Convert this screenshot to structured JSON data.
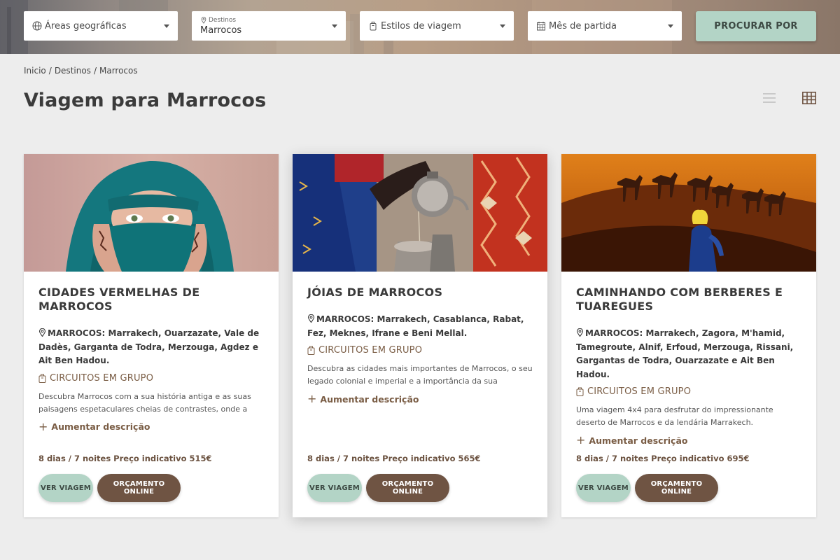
{
  "search": {
    "areas_label": "Áreas geográficas",
    "destinations_caption": "Destinos",
    "destinations_value": "Marrocos",
    "styles_label": "Estilos de viagem",
    "month_label": "Mês de partida",
    "submit_label": "PROCURAR POR"
  },
  "breadcrumb": {
    "home": "Inicio",
    "sep1": "/",
    "destinations": "Destinos",
    "sep2": "/",
    "current": "Marrocos"
  },
  "page": {
    "title": "Viagem para Marrocos"
  },
  "colors": {
    "accent_green": "#b3d4c6",
    "accent_brown": "#6f5443",
    "link_brown": "#7a5d45"
  },
  "icons": {
    "globe": "globe-icon",
    "pin": "map-pin-icon",
    "bag": "luggage-icon",
    "calendar": "calendar-icon",
    "list": "list-view-icon",
    "grid": "grid-view-icon"
  },
  "cards": [
    {
      "title": "CIDADES VERMELHAS DE MARROCOS",
      "location": "MARROCOS: Marrakech, Ouarzazate, Vale de Dadès, Garganta de Todra, Merzouga, Agdez e Ait Ben Hadou.",
      "type": "CIRCUITOS EM GRUPO",
      "description": "Descubra Marrocos com a sua história antiga e as suas paisagens espetaculares cheias de contrastes, onde a naturez...",
      "more": "Aumentar descrição",
      "price": "8 dias / 7 noites Preço indicativo 515€",
      "view_label": "VER VIAGEM",
      "quote_label": "ORÇAMENTO ONLINE"
    },
    {
      "title": "JÓIAS DE MARROCOS",
      "location": "MARROCOS: Marrakech, Casablanca, Rabat, Fez, Meknes, Ifrane e Beni Mellal.",
      "type": "CIRCUITOS EM GRUPO",
      "description": "Descubra as cidades mais importantes de Marrocos, o seu legado colonial e imperial e a importância da sua cultura...",
      "more": "Aumentar descrição",
      "price": "8 dias / 7 noites Preço indicativo 565€",
      "view_label": "VER VIAGEM",
      "quote_label": "ORÇAMENTO ONLINE"
    },
    {
      "title": "CAMINHANDO COM BERBERES E TUAREGUES",
      "location": "MARROCOS: Marrakech, Zagora, M'hamid, Tamegroute, Alnif, Erfoud, Merzouga, Rissani, Gargantas de Todra, Ouarzazate e Ait Ben Hadou.",
      "type": "CIRCUITOS EM GRUPO",
      "description": "Uma viagem 4x4 para desfrutar do impressionante deserto de Marrocos e da lendária Marrakech.",
      "more": "Aumentar descrição",
      "price": "8 dias / 7 noites Preço indicativo 695€",
      "view_label": "VER VIAGEM",
      "quote_label": "ORÇAMENTO ONLINE"
    }
  ]
}
